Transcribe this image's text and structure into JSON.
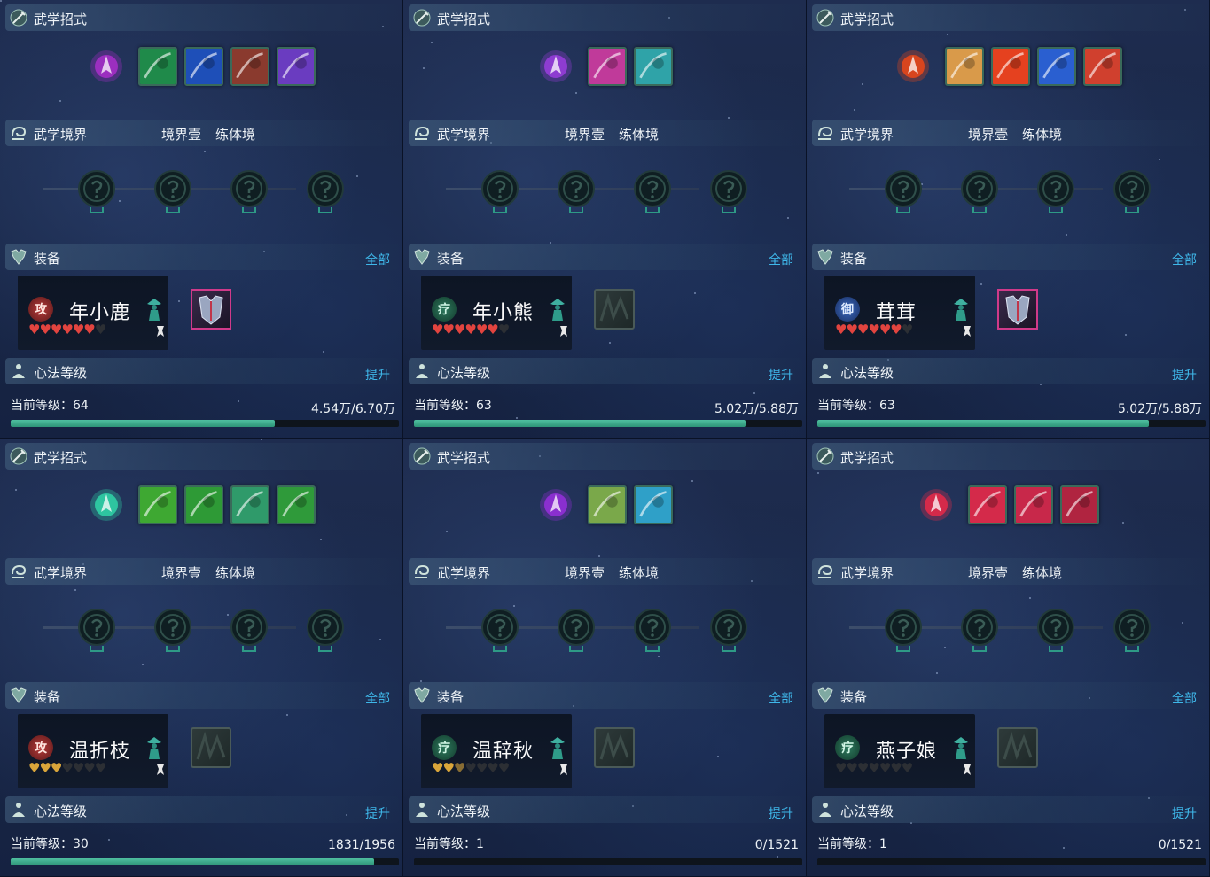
{
  "labels": {
    "skills_title": "武学招式",
    "realm_title": "武学境界",
    "equip_title": "装备",
    "equip_link": "全部",
    "xinfa_title": "心法等级",
    "xinfa_link": "提升"
  },
  "colors": {
    "accent_link": "#3fb8ea",
    "progress": "#3aa98a",
    "heart_red": "#e2443f",
    "heart_gold": "#d9a53a",
    "heart_empty": "#2c2f34"
  },
  "panels": [
    {
      "realm_level": "境界壹",
      "realm_stage": "练体境",
      "skills": [
        "purple-rune",
        "green-leaf",
        "blue-swirl",
        "red-rock",
        "purple-dancer"
      ],
      "skill_colors": [
        "#9b2fbf",
        "#1f8a4a",
        "#1e4fb8",
        "#8a3a2e",
        "#6a3cc0"
      ],
      "character": {
        "name": "年小鹿",
        "role": "攻",
        "role_type": "attack",
        "hearts_filled": 6,
        "heart_color": "red",
        "hearts_total": 7
      },
      "equipment": "armor-piece",
      "level_label": "当前等级：64",
      "level_value": "4.54万/6.70万",
      "progress": 0.68
    },
    {
      "realm_level": "境界壹",
      "realm_stage": "练体境",
      "skills": [
        "purple-cone",
        "pink-leap",
        "cyan-beast"
      ],
      "skill_colors": [
        "#8e3cd1",
        "#c03a9a",
        "#2fa3a8"
      ],
      "character": {
        "name": "年小熊",
        "role": "疗",
        "role_type": "heal",
        "hearts_filled": 6,
        "heart_color": "red",
        "hearts_total": 7
      },
      "equipment": "empty-slot",
      "level_label": "当前等级：63",
      "level_value": "5.02万/5.88万",
      "progress": 0.855
    },
    {
      "realm_level": "境界壹",
      "realm_stage": "练体境",
      "skills": [
        "fire-figure",
        "golden-face",
        "fire-burst",
        "blue-crescent",
        "red-vortex"
      ],
      "skill_colors": [
        "#d8451e",
        "#d99a4a",
        "#e5411f",
        "#2a5fd0",
        "#d0402e"
      ],
      "character": {
        "name": "茸茸",
        "role": "御",
        "role_type": "defense",
        "hearts_filled": 6,
        "heart_color": "red",
        "hearts_total": 7
      },
      "equipment": "armor-piece",
      "level_label": "当前等级：63",
      "level_value": "5.02万/5.88万",
      "progress": 0.855
    },
    {
      "realm_level": "境界壹",
      "realm_stage": "练体境",
      "skills": [
        "green-figure",
        "green-claw",
        "green-slash",
        "green-rings",
        "green-yinyang"
      ],
      "skill_colors": [
        "#2ec5a0",
        "#3ea832",
        "#2e9a36",
        "#2f9a6a",
        "#2f9a3a"
      ],
      "character": {
        "name": "温折枝",
        "role": "攻",
        "role_type": "attack",
        "hearts_filled": 3,
        "heart_color": "gold",
        "hearts_total": 7
      },
      "equipment": "empty-slot",
      "level_label": "当前等级：30",
      "level_value": "1831/1956",
      "progress": 0.936
    },
    {
      "realm_level": "境界壹",
      "realm_stage": "练体境",
      "skills": [
        "purple-figure",
        "green-tree",
        "cyan-orb"
      ],
      "skill_colors": [
        "#8a2fcf",
        "#7aa84a",
        "#2fa0c8"
      ],
      "character": {
        "name": "温辞秋",
        "role": "疗",
        "role_type": "heal",
        "hearts_filled": 2.5,
        "heart_color": "gold",
        "hearts_total": 7
      },
      "equipment": "empty-slot",
      "level_label": "当前等级：1",
      "level_value": "0/1521",
      "progress": 0
    },
    {
      "realm_level": "境界壹",
      "realm_stage": "练体境",
      "skills": [
        "red-slash",
        "red-strike",
        "red-rose",
        "red-warrior"
      ],
      "skill_colors": [
        "#d42a4a",
        "#d42a4a",
        "#c8284a",
        "#b02440"
      ],
      "character": {
        "name": "燕子娘",
        "role": "疗",
        "role_type": "heal",
        "hearts_filled": 0,
        "heart_color": "red",
        "hearts_total": 7
      },
      "equipment": "empty-slot",
      "level_label": "当前等级：1",
      "level_value": "0/1521",
      "progress": 0
    }
  ]
}
